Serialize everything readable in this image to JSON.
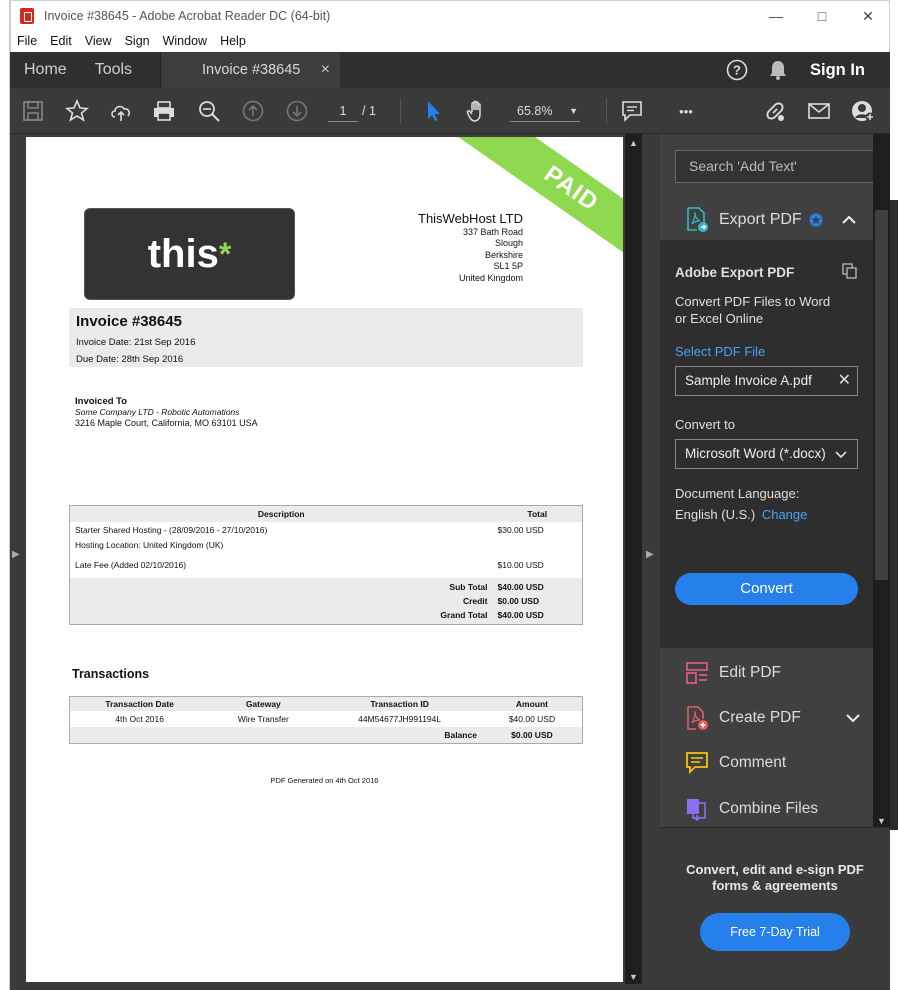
{
  "window": {
    "title": "Invoice #38645 - Adobe Acrobat Reader DC (64-bit)"
  },
  "menu": [
    "File",
    "Edit",
    "View",
    "Sign",
    "Window",
    "Help"
  ],
  "tabs": {
    "home": "Home",
    "tools": "Tools",
    "doc": "Invoice #38645",
    "close": "×",
    "sign_in": "Sign In"
  },
  "toolbar": {
    "page_current": "1",
    "page_total": "/ 1",
    "zoom": "65.8%",
    "more": "•••"
  },
  "invoice": {
    "paid_stamp": "PAID",
    "logo_text": "this",
    "logo_star": "*",
    "company": {
      "name": "ThisWebHost LTD",
      "lines": [
        "337 Bath Road",
        "Slough",
        "Berkshire",
        "SL1 5P",
        "United Kingdom"
      ]
    },
    "heading": "Invoice #38645",
    "invoice_date": "Invoice Date: 21st Sep 2016",
    "due_date": "Due Date: 28th Sep 2016",
    "invoiced_to_label": "Invoiced To",
    "client_name": "Some Company LTD - Robotic Automations",
    "client_address": "3216 Maple Court,   California, MO 63101 USA",
    "items_headers": [
      "Description",
      "Total"
    ],
    "items": [
      {
        "desc": "Starter Shared Hosting - (28/09/2016 - 27/10/2016)",
        "desc2": "Hosting Location: United Kingdom (UK)",
        "total": "$30.00 USD"
      },
      {
        "desc": "Late Fee (Added 02/10/2016)",
        "desc2": "",
        "total": "$10.00 USD"
      }
    ],
    "totals": [
      {
        "label": "Sub Total",
        "value": "$40.00 USD"
      },
      {
        "label": "Credit",
        "value": "$0.00 USD"
      },
      {
        "label": "Grand Total",
        "value": "$40.00 USD"
      }
    ],
    "transactions_heading": "Transactions",
    "trans_headers": [
      "Transaction Date",
      "Gateway",
      "Transaction ID",
      "Amount"
    ],
    "trans_row": [
      "4th Oct 2016",
      "Wire Transfer",
      "44M54677JH991194L",
      "$40.00 USD"
    ],
    "balance_label": "Balance",
    "balance_value": "$0.00 USD",
    "footer": "PDF Generated on 4th Oct 2016"
  },
  "pane": {
    "search_placeholder": "Search 'Add Text'",
    "export_label": "Export PDF",
    "export_title": "Adobe Export PDF",
    "export_desc1": "Convert PDF Files to Word",
    "export_desc2": "or Excel Online",
    "select_pdf": "Select PDF File",
    "file_name": "Sample Invoice A.pdf",
    "convert_to": "Convert to",
    "format": "Microsoft Word (*.docx)",
    "doc_lang": "Document Language:",
    "lang": "English (U.S.)",
    "change": "Change",
    "convert_btn": "Convert",
    "tools": [
      "Edit PDF",
      "Create PDF",
      "Comment",
      "Combine Files"
    ],
    "promo_text": "Convert, edit and e-sign PDF forms & agreements",
    "trial_btn": "Free 7-Day Trial"
  },
  "colors": {
    "accent": "#2680eb",
    "paid_green": "#8ed94f"
  }
}
